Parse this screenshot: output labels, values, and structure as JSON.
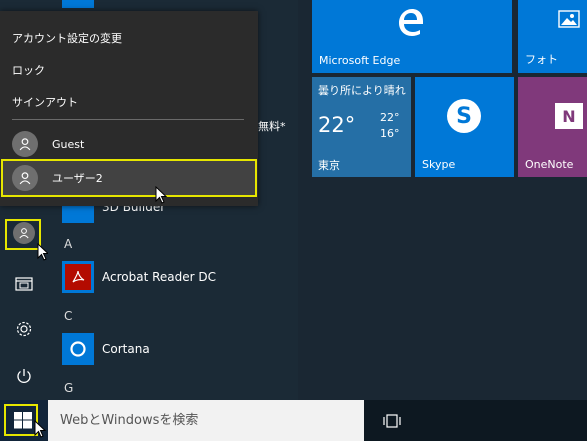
{
  "flyout": {
    "account_settings": "アカウント設定の変更",
    "lock": "ロック",
    "sign_out": "サインアウト",
    "users": [
      {
        "name": "Guest"
      },
      {
        "name": "ユーザー2"
      }
    ]
  },
  "apps": {
    "partial_top": "3D Builder",
    "sections": [
      {
        "letter": "A",
        "apps": [
          "Acrobat Reader DC"
        ]
      },
      {
        "letter": "C",
        "apps": [
          "Cortana"
        ]
      },
      {
        "letter": "G",
        "apps": []
      }
    ],
    "partial_free_label": "無料*"
  },
  "tiles": {
    "edge": "Microsoft Edge",
    "photos": "フォト",
    "weather": {
      "condition": "曇り所により晴れ",
      "temp": "22°",
      "high": "22°",
      "low": "16°",
      "city": "東京"
    },
    "skype": "Skype",
    "onenote": "OneNote"
  },
  "taskbar": {
    "search_placeholder": "WebとWindowsを検索"
  },
  "colors": {
    "accent": "#0078d7",
    "onenote": "#80397b",
    "highlight": "#e6e600"
  }
}
